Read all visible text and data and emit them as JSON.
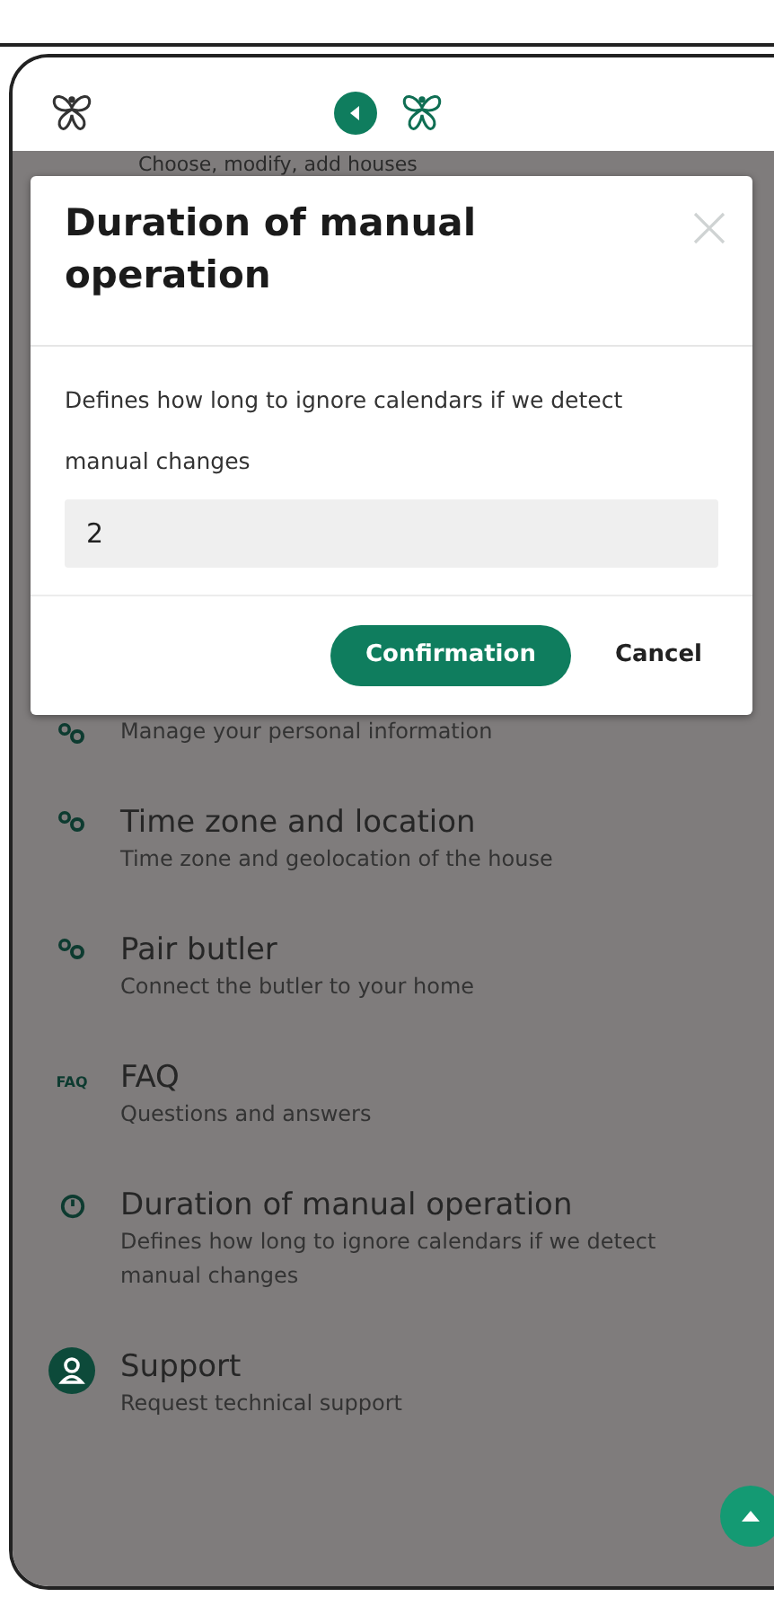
{
  "menu_items": [
    {
      "subtitle": "Choose, modify, add houses"
    },
    {
      "kind": "links",
      "subtitle": "Manage your personal information"
    },
    {
      "kind": "links",
      "title": "Time zone and location",
      "subtitle": "Time zone and geolocation of the house"
    },
    {
      "kind": "links",
      "title": "Pair butler",
      "subtitle": "Connect the butler to your home"
    },
    {
      "kind": "faq",
      "icon_text": "FAQ",
      "title": "FAQ",
      "subtitle": "Questions and answers"
    },
    {
      "kind": "clock",
      "title": "Duration of manual operation",
      "subtitle": "Defines how long to ignore calendars if we detect manual changes"
    },
    {
      "kind": "user",
      "title": "Support",
      "subtitle": "Request technical support"
    }
  ],
  "dialog": {
    "title": "Duration of manual operation",
    "description": "Defines how long to ignore calendars if we detect manual changes",
    "value": "2",
    "buttons": [
      {
        "label": "Confirmation",
        "kind": "primary"
      },
      {
        "label": "Cancel",
        "kind": "plain"
      }
    ]
  }
}
